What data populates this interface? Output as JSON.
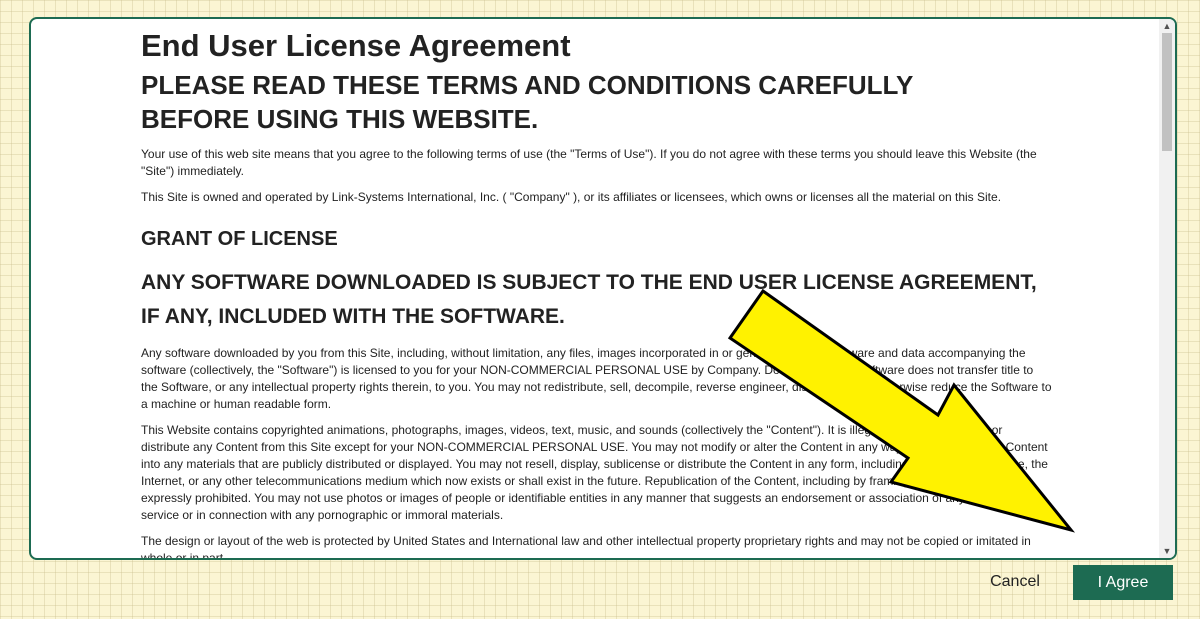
{
  "dialog": {
    "title": "End User License Agreement",
    "heading_line1": "PLEASE READ THESE TERMS AND CONDITIONS CAREFULLY",
    "heading_line2": "BEFORE USING THIS WEBSITE.",
    "paragraph1": "Your use of this web site means that you agree to the following terms of use (the \"Terms of Use\"). If you do not agree with these terms you should leave this Website (the \"Site\") immediately.",
    "paragraph2": "This Site is owned and operated by Link-Systems International, Inc. ( \"Company\" ), or its affiliates or licensees, which owns or licenses all the material on this Site.",
    "section_heading": "GRANT OF LICENSE",
    "subject_heading_line1": "ANY SOFTWARE DOWNLOADED IS SUBJECT TO THE END USER LICENSE AGREEMENT,",
    "subject_heading_line2": "IF ANY, INCLUDED WITH THE SOFTWARE.",
    "paragraph3": "Any software downloaded by you from this Site, including, without limitation, any files, images incorporated in or generated by the software and data accompanying the software (collectively, the \"Software\") is licensed to you for your NON-COMMERCIAL PERSONAL USE by Company. Downloading the Software does not transfer title to the Software, or any intellectual property rights therein, to you. You may not redistribute, sell, decompile, reverse engineer, disassemble or otherwise reduce the Software to a machine or human readable form.",
    "paragraph4": "This Website contains copyrighted animations, photographs, images, videos, text, music, and sounds (collectively the \"Content\"). It is illegal for you to download or distribute any Content from this Site except for your NON-COMMERCIAL PERSONAL USE. You may not modify or alter the Content in any way, or incorporate the Content into any materials that are publicly distributed or displayed. You may not resell, display, sublicense or distribute the Content in any form, including on any online service, the Internet, or any other telecommunications medium which now exists or shall exist in the future. Republication of the Content, including by framing or similar means, is expressly prohibited. You may not use photos or images of people or identifiable entities in any manner that suggests an endorsement or association of any product or service or in connection with any pornographic or immoral materials.",
    "paragraph5": "The design or layout of the web is protected by United States and International law and other intellectual property proprietary rights and may not be copied or imitated in whole or in part."
  },
  "scrollbar": {
    "up_icon": "▲",
    "down_icon": "▼"
  },
  "buttons": {
    "cancel_label": "Cancel",
    "agree_label": "I Agree"
  },
  "colors": {
    "accent": "#1d6b52",
    "arrow_fill": "#fff200",
    "arrow_stroke": "#000000",
    "page_background": "#fbf5d3"
  },
  "icons": {
    "arrow": "yellow-pointer-arrow-icon"
  }
}
